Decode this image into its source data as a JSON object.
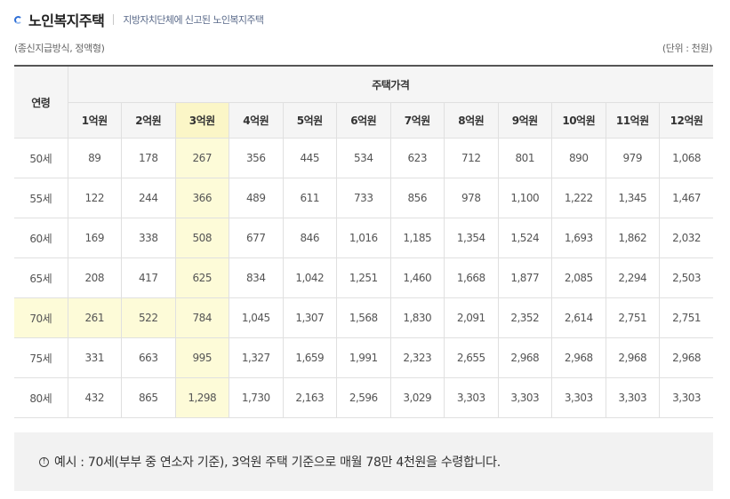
{
  "header": {
    "title": "노인복지주택",
    "subtitle": "지방자치단체에 신고된 노인복지주택"
  },
  "meta": {
    "left": "(종신지급방식, 정액형)",
    "right": "(단위 : 천원)"
  },
  "table": {
    "age_header": "연령",
    "price_header": "주택가격",
    "columns": [
      "1억원",
      "2억원",
      "3억원",
      "4억원",
      "5억원",
      "6억원",
      "7억원",
      "8억원",
      "9억원",
      "10억원",
      "11억원",
      "12억원"
    ],
    "rows": [
      {
        "age": "50세",
        "values": [
          "89",
          "178",
          "267",
          "356",
          "445",
          "534",
          "623",
          "712",
          "801",
          "890",
          "979",
          "1,068"
        ]
      },
      {
        "age": "55세",
        "values": [
          "122",
          "244",
          "366",
          "489",
          "611",
          "733",
          "856",
          "978",
          "1,100",
          "1,222",
          "1,345",
          "1,467"
        ]
      },
      {
        "age": "60세",
        "values": [
          "169",
          "338",
          "508",
          "677",
          "846",
          "1,016",
          "1,185",
          "1,354",
          "1,524",
          "1,693",
          "1,862",
          "2,032"
        ]
      },
      {
        "age": "65세",
        "values": [
          "208",
          "417",
          "625",
          "834",
          "1,042",
          "1,251",
          "1,460",
          "1,668",
          "1,877",
          "2,085",
          "2,294",
          "2,503"
        ]
      },
      {
        "age": "70세",
        "values": [
          "261",
          "522",
          "784",
          "1,045",
          "1,307",
          "1,568",
          "1,830",
          "2,091",
          "2,352",
          "2,614",
          "2,751",
          "2,751"
        ]
      },
      {
        "age": "75세",
        "values": [
          "331",
          "663",
          "995",
          "1,327",
          "1,659",
          "1,991",
          "2,323",
          "2,655",
          "2,968",
          "2,968",
          "2,968",
          "2,968"
        ]
      },
      {
        "age": "80세",
        "values": [
          "432",
          "865",
          "1,298",
          "1,730",
          "2,163",
          "2,596",
          "3,029",
          "3,303",
          "3,303",
          "3,303",
          "3,303",
          "3,303"
        ]
      }
    ],
    "highlight_color_column": "#fdfbd8",
    "highlight_color_cell": "#e6ecfb"
  },
  "note": {
    "icon": "info-icon",
    "icon_glyph": "!",
    "text": "예시 : 70세(부부 중 연소자 기준), 3억원 주택 기준으로 매월 78만 4천원을 수령합니다."
  }
}
